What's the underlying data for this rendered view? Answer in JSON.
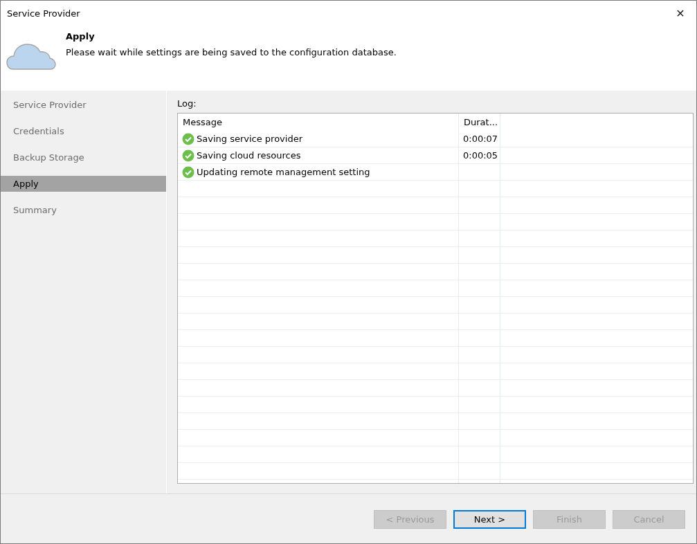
{
  "window": {
    "title": "Service Provider",
    "close": "✕"
  },
  "header": {
    "title": "Apply",
    "description": "Please wait while settings are being saved to the configuration database."
  },
  "sidebar": {
    "items": [
      {
        "label": "Service Provider",
        "selected": false
      },
      {
        "label": "Credentials",
        "selected": false
      },
      {
        "label": "Backup Storage",
        "selected": false
      },
      {
        "label": "Apply",
        "selected": true
      },
      {
        "label": "Summary",
        "selected": false
      }
    ]
  },
  "log": {
    "label": "Log:",
    "columns": [
      "Message",
      "Durat..."
    ],
    "rows": [
      {
        "kind": "success",
        "message": "Saving service provider",
        "duration": "0:00:07"
      },
      {
        "kind": "success",
        "message": "Saving cloud resources",
        "duration": "0:00:05"
      },
      {
        "kind": "success",
        "message": "Updating remote management setting"
      }
    ]
  },
  "buttons": [
    {
      "label": "< Previous",
      "disabled": true,
      "focused": false
    },
    {
      "label": "Next >",
      "disabled": false,
      "focused": true
    },
    {
      "label": "Finish",
      "disabled": true,
      "focused": false
    },
    {
      "label": "Cancel",
      "disabled": true,
      "focused": false
    }
  ]
}
